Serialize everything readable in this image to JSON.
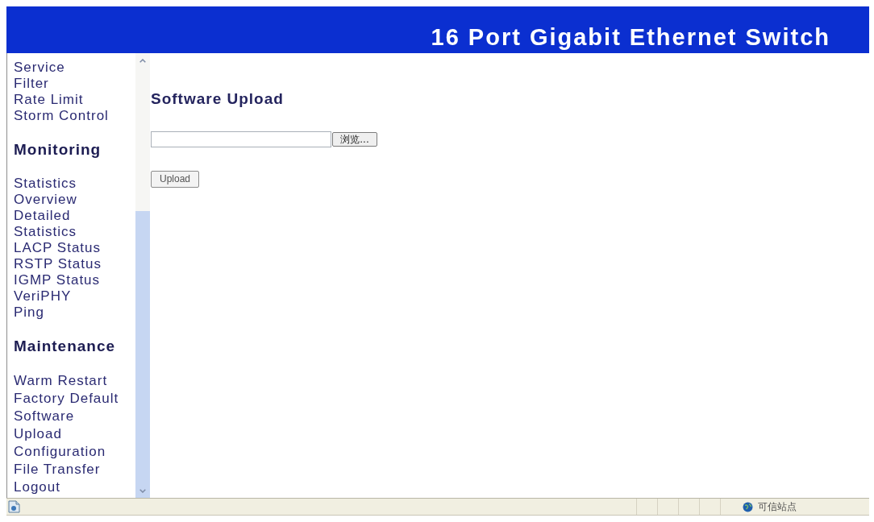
{
  "header": {
    "title": "16 Port Gigabit Ethernet Switch"
  },
  "sidebar": {
    "groups": [
      {
        "items": [
          "Service",
          "Filter",
          "Rate Limit",
          "Storm Control"
        ]
      },
      {
        "heading": "Monitoring",
        "items": [
          "Statistics Overview",
          "Detailed Statistics",
          "LACP Status",
          "RSTP Status",
          "IGMP Status",
          "VeriPHY",
          "Ping"
        ]
      },
      {
        "heading": "Maintenance",
        "items": [
          "Warm Restart",
          "Factory Default",
          "Software Upload",
          "Configuration File Transfer",
          "Logout"
        ]
      }
    ]
  },
  "main": {
    "title": "Software Upload",
    "file_field": {
      "browse_button": "浏览..."
    },
    "upload_button": "Upload"
  },
  "status_bar": {
    "zone": "可信站点"
  }
}
